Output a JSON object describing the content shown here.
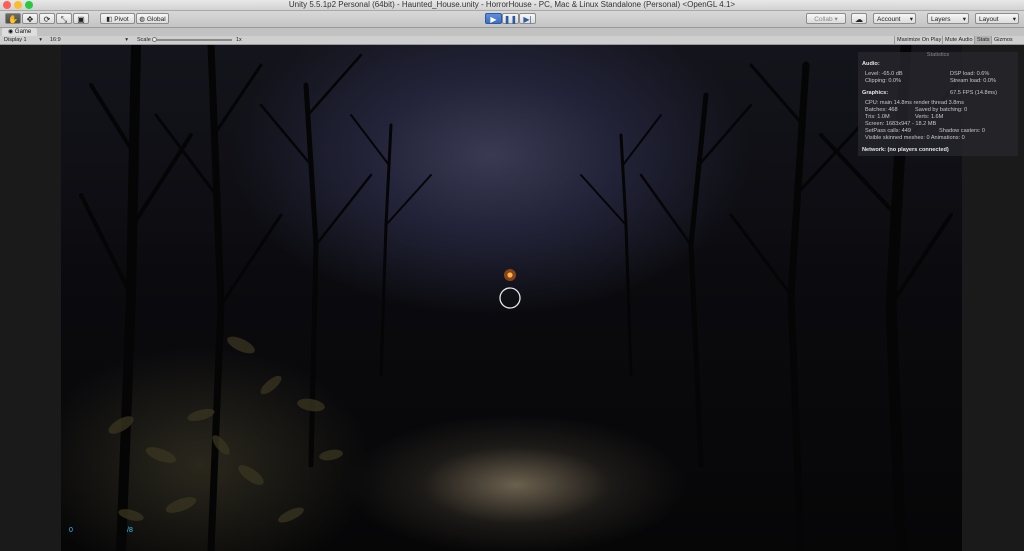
{
  "window": {
    "title": "Unity 5.5.1p2 Personal (64bit) - Haunted_House.unity - HorrorHouse - PC, Mac & Linux Standalone (Personal) <OpenGL 4.1>"
  },
  "toolbar": {
    "pivot_label": "Pivot",
    "global_label": "Global",
    "collab_label": "Collab",
    "account_label": "Account",
    "layers_label": "Layers",
    "layout_label": "Layout"
  },
  "game_view": {
    "tab_label": "Game",
    "display": "Display 1",
    "aspect": "16:9",
    "scale_label": "Scale",
    "scale_value": "1x",
    "maximize_label": "Maximize On Play",
    "mute_label": "Mute Audio",
    "stats_label": "Stats",
    "gizmos_label": "Gizmos"
  },
  "stats": {
    "title": "Statistics",
    "audio_header": "Audio:",
    "level": "Level: -65.0 dB",
    "dsp_load": "DSP load: 0.6%",
    "clipping": "Clipping: 0.0%",
    "stream_load": "Stream load: 0.0%",
    "graphics_header": "Graphics:",
    "fps": "67.5 FPS (14.8ms)",
    "cpu": "CPU: main 14.8ms  render thread 3.8ms",
    "batches": "Batches: 468",
    "saved_batching": "Saved by batching: 0",
    "tris": "Tris: 1.0M",
    "verts": "Verts: 1.6M",
    "screen": "Screen: 1683x947 - 18.2 MB",
    "setpass": "SetPass calls: 449",
    "shadow_casters": "Shadow casters: 0",
    "skinned": "Visible skinned meshes: 0  Animations: 0",
    "network": "Network: (no players connected)"
  },
  "hud": {
    "left_value": "0",
    "right_value": "/8"
  }
}
